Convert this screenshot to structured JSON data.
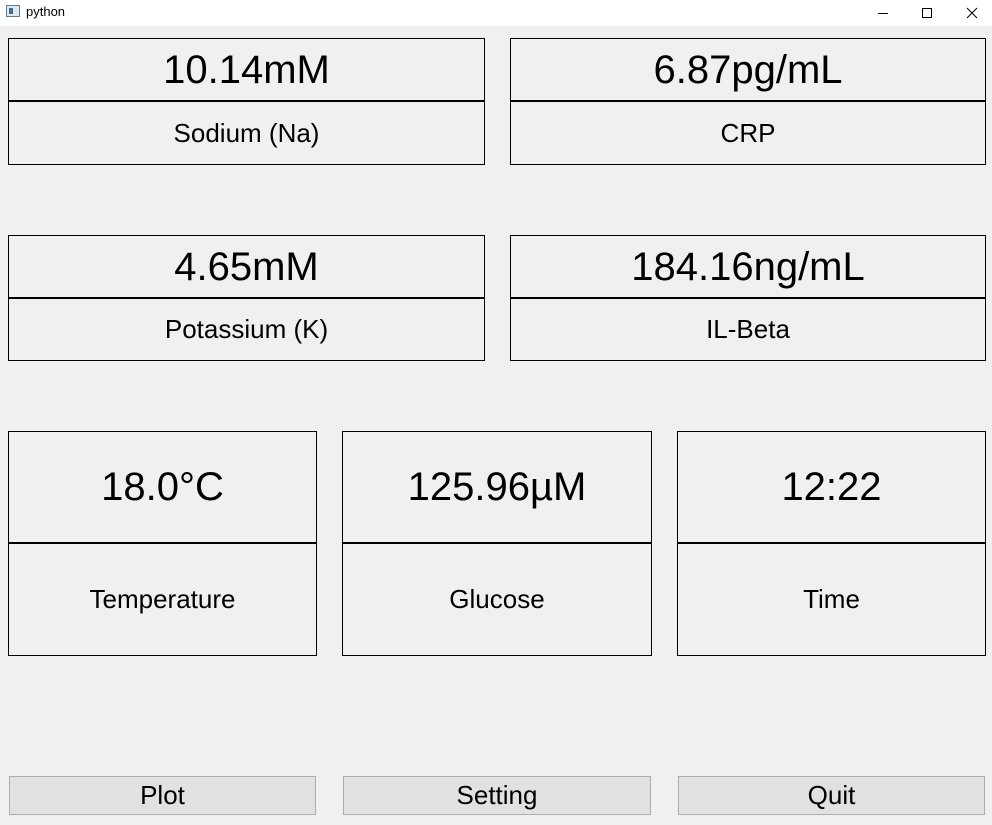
{
  "window": {
    "title": "python"
  },
  "readings": {
    "sodium": {
      "value": "10.14mM",
      "label": "Sodium (Na)"
    },
    "crp": {
      "value": "6.87pg/mL",
      "label": "CRP"
    },
    "potassium": {
      "value": "4.65mM",
      "label": "Potassium (K)"
    },
    "il_beta": {
      "value": "184.16ng/mL",
      "label": "IL-Beta"
    },
    "temperature": {
      "value": "18.0°C",
      "label": "Temperature"
    },
    "glucose": {
      "value": "125.96µM",
      "label": "Glucose"
    },
    "time": {
      "value": "12:22",
      "label": "Time"
    }
  },
  "buttons": {
    "plot": "Plot",
    "setting": "Setting",
    "quit": "Quit"
  }
}
